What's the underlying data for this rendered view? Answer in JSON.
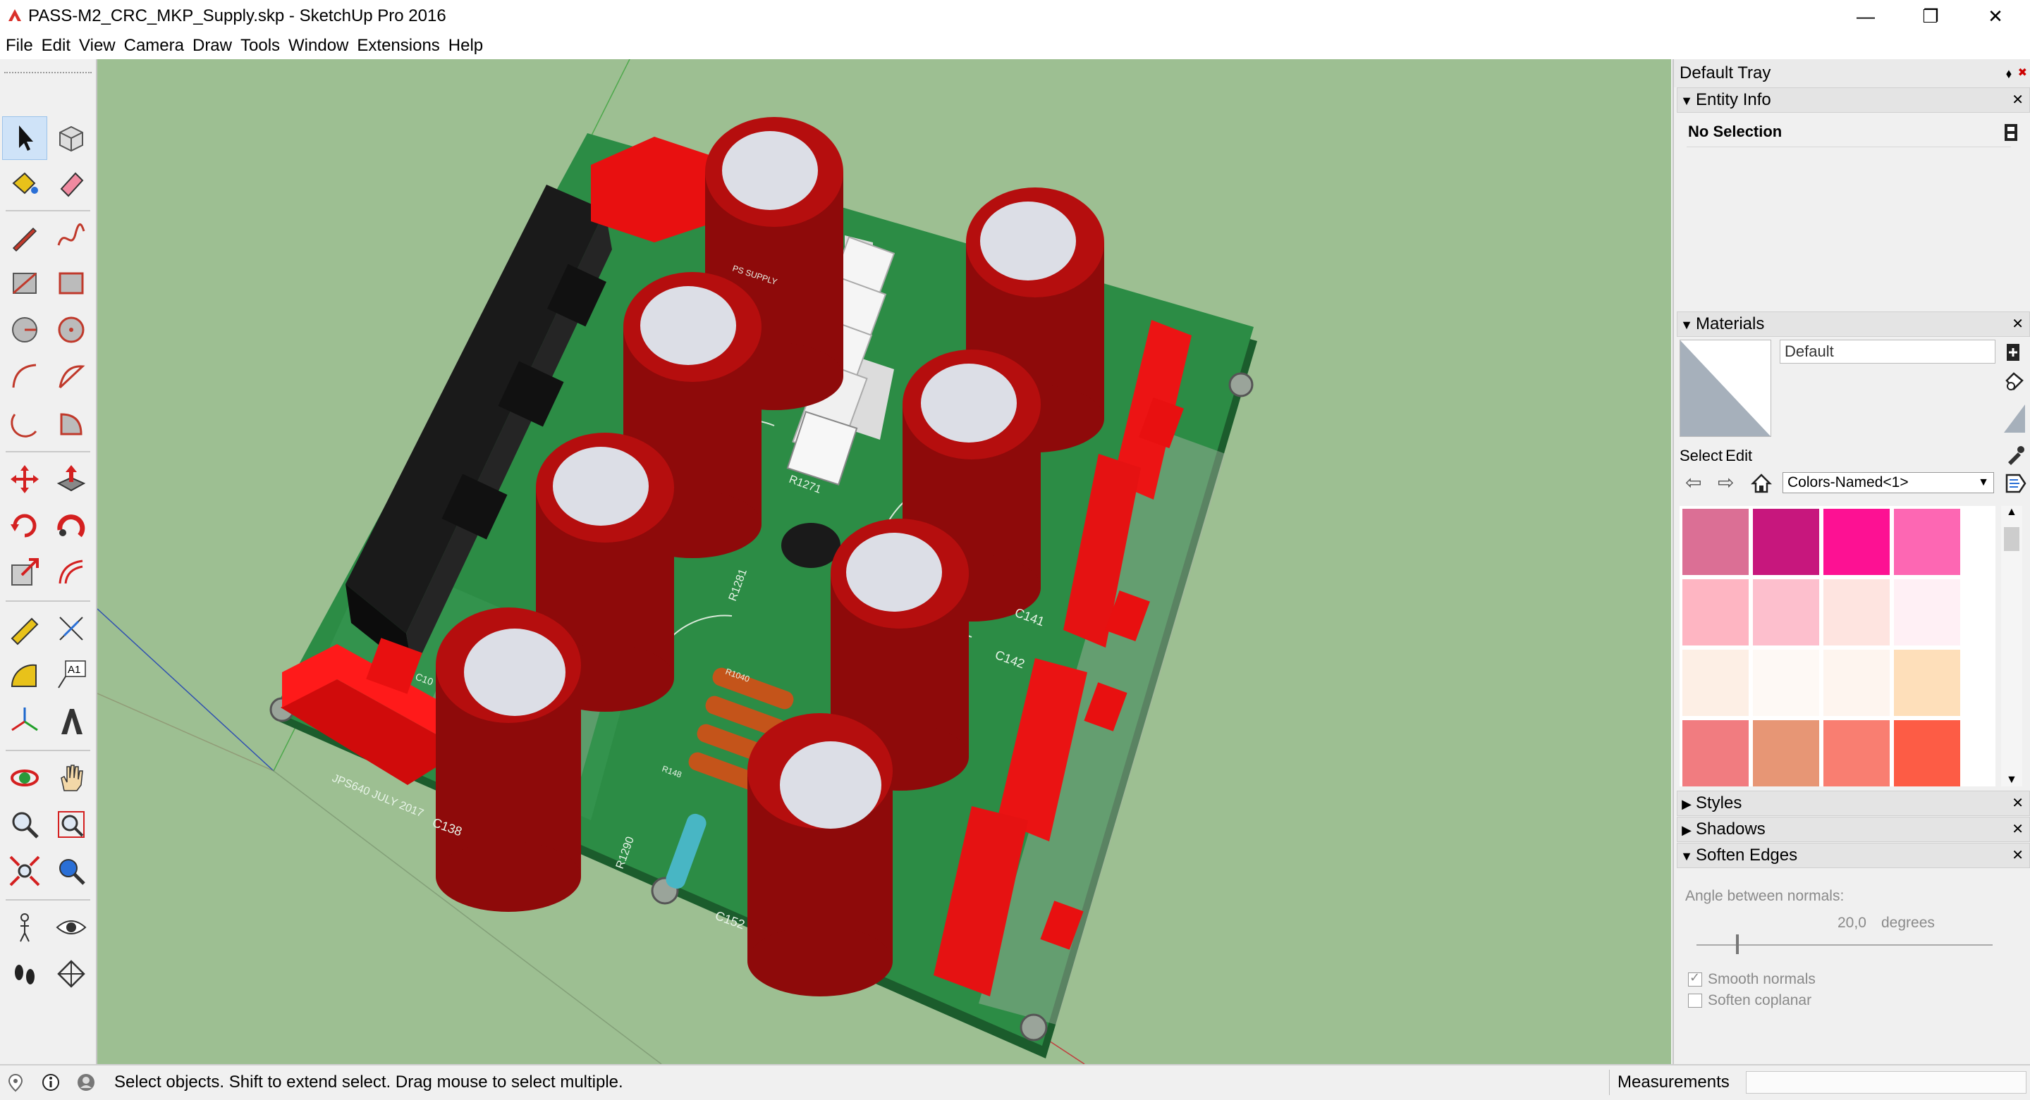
{
  "window": {
    "title": "PASS-M2_CRC_MKP_Supply.skp - SketchUp Pro 2016",
    "controls": [
      "minimize-icon",
      "restore-icon",
      "close-icon"
    ]
  },
  "menu": [
    "File",
    "Edit",
    "View",
    "Camera",
    "Draw",
    "Tools",
    "Window",
    "Extensions",
    "Help"
  ],
  "toolbar": {
    "tools": [
      "select",
      "make-component",
      "paint-bucket",
      "eraser",
      "line",
      "freehand",
      "rectangle",
      "rotated-rectangle",
      "circle",
      "polygon",
      "arc",
      "two-point-arc",
      "three-point-arc",
      "pie",
      "move",
      "push-pull",
      "rotate",
      "follow-me",
      "scale",
      "offset",
      "tape-measure",
      "dimension",
      "protractor",
      "text",
      "axes",
      "3d-text",
      "orbit",
      "pan",
      "zoom",
      "zoom-window",
      "zoom-extents",
      "previous-view",
      "position-camera",
      "look-around",
      "walk",
      "section-plane"
    ],
    "text_tool_label": "A1"
  },
  "viewport": {
    "board_labels": [
      "PS SUPPLY",
      "C141",
      "C142",
      "C138",
      "C152",
      "R1281",
      "R1271",
      "R1040",
      "R1290",
      "R148",
      "C10",
      "JPS640 JULY 2017"
    ]
  },
  "tray": {
    "title": "Default Tray",
    "entity_info": {
      "header": "Entity Info",
      "selection": "No Selection"
    },
    "materials": {
      "header": "Materials",
      "name_value": "Default",
      "tabs": [
        "Select",
        "Edit"
      ],
      "collection": "Colors-Named<1>",
      "swatches": [
        "#db6f95",
        "#c7177d",
        "#fd1193",
        "#fd67b3",
        "#feb5c2",
        "#fdbfcd",
        "#fee4e0",
        "#fff0f5",
        "#fdefe5",
        "#fef9f5",
        "#fef5ef",
        "#fedfba",
        "#f17c80",
        "#e79675",
        "#f97e71",
        "#fd5c45"
      ]
    },
    "panels": [
      "Styles",
      "Shadows",
      "Soften Edges"
    ],
    "soften_edges": {
      "angle_label": "Angle between normals:",
      "angle_value": "20,0",
      "angle_unit": "degrees",
      "options": [
        {
          "label": "Smooth normals",
          "checked": true
        },
        {
          "label": "Soften coplanar",
          "checked": false
        }
      ]
    }
  },
  "status": {
    "message": "Select objects. Shift to extend select. Drag mouse to select multiple.",
    "measurements_label": "Measurements",
    "measurements_value": ""
  }
}
